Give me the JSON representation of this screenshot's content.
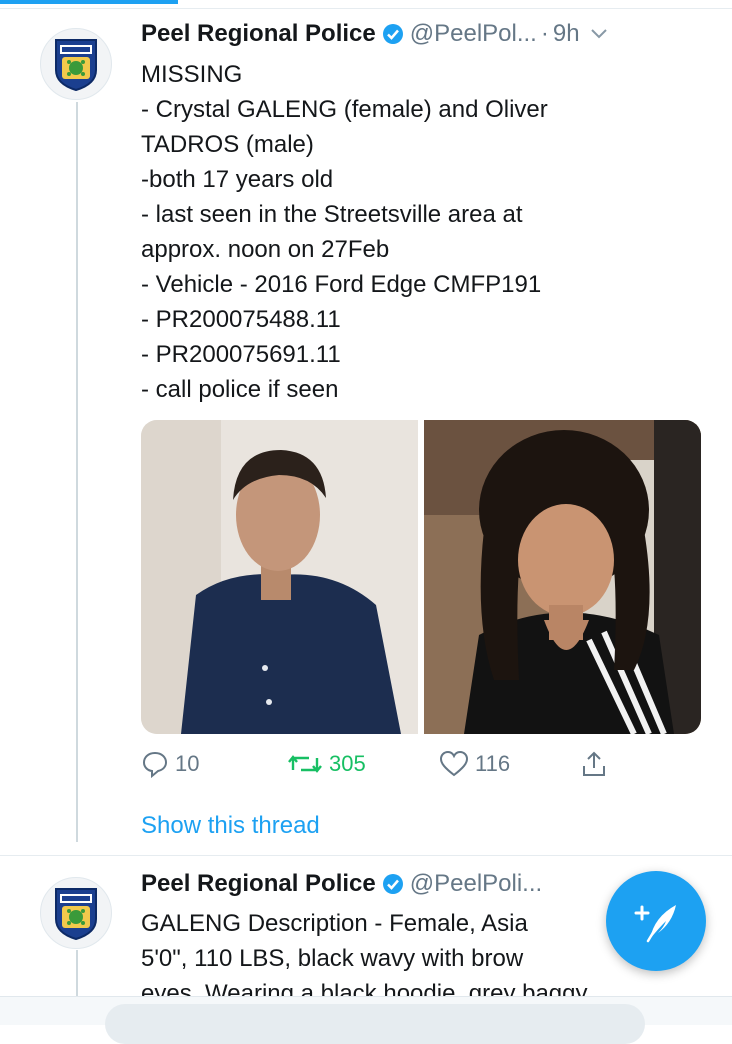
{
  "tweets": [
    {
      "author": "Peel Regional Police",
      "handle": "@PeelPol...",
      "separator": "·",
      "time": "9h",
      "avatar_icon": "police-badge-icon",
      "lines": [
        "MISSING",
        "- Crystal GALENG (female) and Oliver",
        "TADROS (male)",
        "-both 17 years old",
        "- last seen in the Streetsville area at",
        "approx. noon on 27Feb",
        "- Vehicle - 2016 Ford Edge CMFP191",
        "- PR200075488.11",
        "- PR200075691.11",
        "- call police if seen"
      ],
      "actions": {
        "replies": "10",
        "retweets": "305",
        "likes": "116"
      },
      "show_thread": "Show this thread"
    },
    {
      "author": "Peel Regional Police",
      "handle": "@PeelPoli...",
      "lines": [
        "GALENG Description -  Female, Asia",
        "5'0\", 110 LBS, black wavy  with brow",
        "eyes. Wearing a black hoodie, grey baggy"
      ]
    }
  ],
  "colors": {
    "accent": "#1da1f2",
    "retweet": "#17bf63",
    "muted": "#657786",
    "text": "#14171a"
  },
  "compose_button_icon": "feather-plus-icon"
}
